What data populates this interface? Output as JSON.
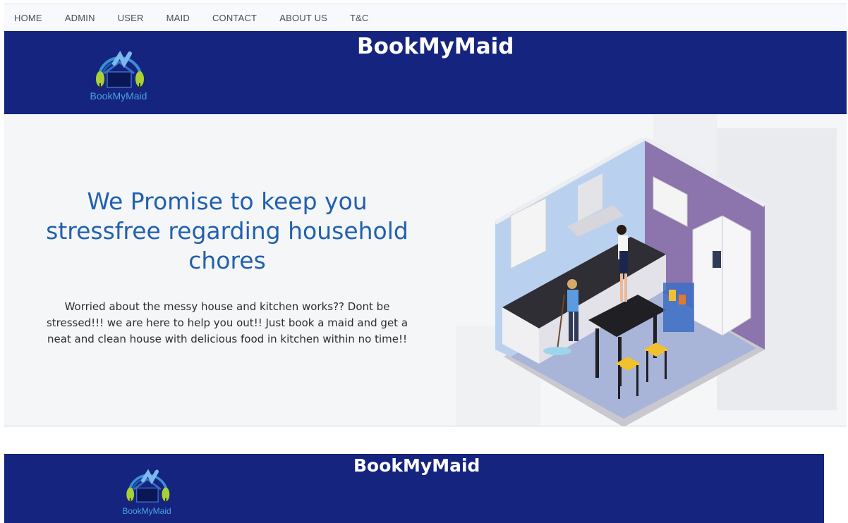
{
  "nav": {
    "items": [
      {
        "label": "HOME"
      },
      {
        "label": "ADMIN"
      },
      {
        "label": "USER"
      },
      {
        "label": "MAID"
      },
      {
        "label": "CONTACT"
      },
      {
        "label": "ABOUT US"
      },
      {
        "label": "T&C"
      }
    ]
  },
  "header": {
    "title": "BookMyMaid",
    "logo_text": "BookMyMaid",
    "logo_icon": "house-tree-logo-icon"
  },
  "hero": {
    "heading": "We Promise to keep you stressfree regarding household chores",
    "body": "Worried about the messy house and kitchen works?? Dont be stressed!!! we are here to help you out!! Just book a maid and get a neat and clean house with delicious food in kitchen within no time!!",
    "illustration_icon": "kitchen-maid-illustration-icon"
  },
  "footer_header": {
    "title": "BookMyMaid",
    "logo_text": "BookMyMaid"
  },
  "colors": {
    "header_bg": "#15247e",
    "heading_blue": "#2160b0",
    "logo_blue": "#4aa3df"
  }
}
